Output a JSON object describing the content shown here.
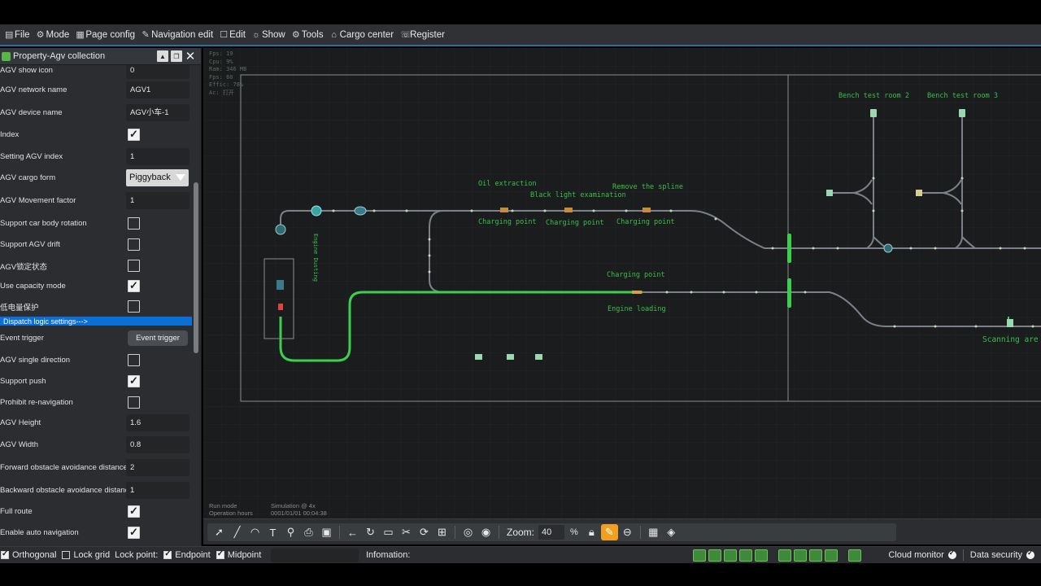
{
  "menu": [
    {
      "label": "File",
      "icon": "file-icon",
      "glyph": "🗎"
    },
    {
      "label": "Mode",
      "icon": "gear-icon",
      "glyph": "⚙"
    },
    {
      "label": "Page config",
      "icon": "page-config-icon",
      "glyph": "⚙"
    },
    {
      "label": "Navigation edit",
      "icon": "pencil-icon",
      "glyph": "✎"
    },
    {
      "label": "Edit",
      "icon": "edit-icon",
      "glyph": "✎"
    },
    {
      "label": "Show",
      "icon": "sun-icon",
      "glyph": "☼"
    },
    {
      "label": "Tools",
      "icon": "tools-icon",
      "glyph": "⚙"
    },
    {
      "label": "Cargo center",
      "icon": "home-icon",
      "glyph": "⌂"
    },
    {
      "label": "Register",
      "icon": "register-icon",
      "glyph": "☏"
    }
  ],
  "panel": {
    "title": "Property-Agv collection",
    "rows": [
      {
        "label": "AGV show icon",
        "type": "text",
        "value": "0"
      },
      {
        "label": "AGV network name",
        "type": "text",
        "value": "AGV1"
      },
      {
        "label": "AGV device name",
        "type": "text",
        "value": "AGV小车-1"
      },
      {
        "label": "Index",
        "type": "check",
        "checked": true
      },
      {
        "label": "Setting AGV index",
        "type": "text",
        "value": "1"
      },
      {
        "label": "AGV cargo form",
        "type": "select",
        "value": "Piggyback"
      },
      {
        "label": "AGV Movement factor",
        "type": "text",
        "value": "1"
      },
      {
        "label": "Support car body rotation",
        "type": "check",
        "checked": false
      },
      {
        "label": "Support AGV drift",
        "type": "check",
        "checked": false
      },
      {
        "label": "AGV锁定状态",
        "type": "check",
        "checked": false
      },
      {
        "label": "Use capacity mode",
        "type": "check",
        "checked": true
      },
      {
        "label": "低电量保护",
        "type": "check",
        "checked": false
      },
      {
        "label": "Dispatch logic settings--->",
        "type": "section"
      },
      {
        "label": "Event trigger",
        "type": "button",
        "value": "Event trigger"
      },
      {
        "label": "AGV single direction",
        "type": "check",
        "checked": false
      },
      {
        "label": "Support push",
        "type": "check",
        "checked": true
      },
      {
        "label": "Prohibit re-navigation",
        "type": "check",
        "checked": false
      },
      {
        "label": "AGV Height",
        "type": "text",
        "value": "1.6"
      },
      {
        "label": "AGV Width",
        "type": "text",
        "value": "0.8"
      },
      {
        "label": "Forward obstacle avoidance distance",
        "type": "text",
        "value": "2"
      },
      {
        "label": "Backward obstacle avoidance distance",
        "type": "text",
        "value": "1"
      },
      {
        "label": "Full route",
        "type": "check",
        "checked": true
      },
      {
        "label": "Enable auto navigation",
        "type": "check",
        "checked": true
      }
    ]
  },
  "canvas": {
    "stats": [
      "Fps: 19",
      "Cpu: 9%",
      "Ram: 346 MB",
      "Fps: 60",
      "Effic: 78%",
      "Ac: 打开"
    ],
    "run_mode_label": "Run mode",
    "run_mode_value": "Simulation @ 4x",
    "operation_hours_label": "Operation hours",
    "operation_hours_value": "0001/01/01 00:04:38",
    "labels": {
      "oil_extraction": "Oil extraction",
      "black_light": "Black light examination",
      "remove_spline": "Remove the spline",
      "charging_point_1": "Charging point",
      "charging_point_2": "Charging point",
      "charging_point_3": "Charging point",
      "charging_point_4": "Charging point",
      "engine_loading": "Engine loading",
      "engine_dusting": "Engine Dusting",
      "bench_room_2": "Bench test room 2",
      "bench_room_3": "Bench test room 3",
      "scanning_area": "Scanning are"
    }
  },
  "toolbar": {
    "zoom_label": "Zoom:",
    "zoom_value": "40",
    "zoom_unit": "%"
  },
  "statusbar": {
    "orthogonal": "Orthogonal",
    "lock_grid": "Lock grid",
    "lock_point": "Lock point:",
    "endpoint": "Endpoint",
    "midpoint": "Midpoint",
    "information": "Infomation:",
    "cloud_monitor": "Cloud monitor",
    "data_security": "Data security"
  },
  "colors": {
    "accent_blue": "#0a6fd6",
    "track_green": "#3ccf4e",
    "track_gray": "#7c8088",
    "label_green": "#3bbf4a"
  }
}
